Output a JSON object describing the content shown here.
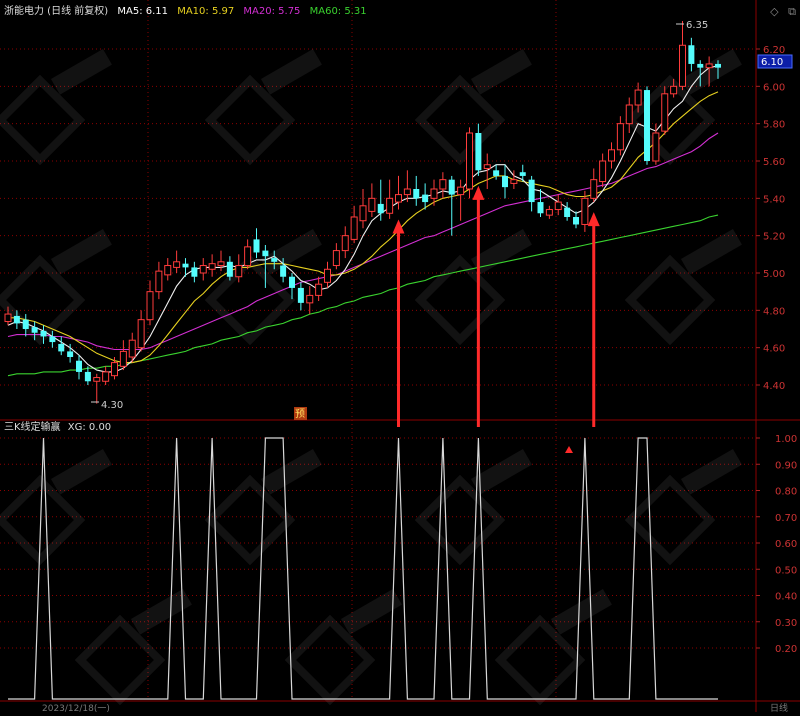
{
  "app": {
    "stock_title": "浙能电力 (日线 前复权)",
    "main_indicator": {
      "name": "MA",
      "values": [
        {
          "label": "MA5:",
          "value": "6.11",
          "color": "#ffffff"
        },
        {
          "label": "MA10:",
          "value": "5.97",
          "color": "#e6d020"
        },
        {
          "label": "MA20:",
          "value": "5.75",
          "color": "#d22fd2"
        },
        {
          "label": "MA60:",
          "value": "5.31",
          "color": "#3ad22f"
        }
      ]
    },
    "sub_indicator": {
      "name": "三K线定输赢",
      "xg_label": "XG:",
      "xg_value": "0.00"
    },
    "current_price_label": "6.10",
    "high_label": "6.35",
    "low_label": "4.30",
    "forecast_badge": "预",
    "bottom_date_label": "2023/12/18(一)",
    "bottom_right_label": "日线",
    "toolbar_icons": [
      "diamond-icon",
      "restore-icon"
    ]
  },
  "colors": {
    "up": "#ff3c3c",
    "down": "#54fcfc",
    "grid": "#8b0000",
    "axis_text": "#cc3333",
    "indicator_line": "#d8d8d8",
    "arrow": "#ff2a2a",
    "watermark": "#ffffff"
  },
  "chart_data": [
    {
      "type": "candlestick",
      "y_axis_ticks": [
        "6.20",
        "6.00",
        "5.80",
        "5.60",
        "5.40",
        "5.20",
        "5.00",
        "4.80",
        "4.60",
        "4.40"
      ],
      "ylim": [
        4.26,
        6.4
      ],
      "candles": [
        [
          4.74,
          4.78,
          4.82,
          4.72
        ],
        [
          4.77,
          4.73,
          4.8,
          4.7
        ],
        [
          4.75,
          4.7,
          4.78,
          4.66
        ],
        [
          4.71,
          4.68,
          4.74,
          4.64
        ],
        [
          4.69,
          4.66,
          4.72,
          4.62
        ],
        [
          4.66,
          4.63,
          4.69,
          4.6
        ],
        [
          4.62,
          4.58,
          4.66,
          4.56
        ],
        [
          4.58,
          4.55,
          4.62,
          4.52
        ],
        [
          4.53,
          4.47,
          4.56,
          4.43
        ],
        [
          4.47,
          4.42,
          4.5,
          4.4
        ],
        [
          4.42,
          4.44,
          4.46,
          4.3
        ],
        [
          4.42,
          4.47,
          4.5,
          4.4
        ],
        [
          4.45,
          4.52,
          4.55,
          4.43
        ],
        [
          4.5,
          4.58,
          4.64,
          4.48
        ],
        [
          4.55,
          4.64,
          4.68,
          4.52
        ],
        [
          4.6,
          4.75,
          4.8,
          4.58
        ],
        [
          4.75,
          4.9,
          4.96,
          4.72
        ],
        [
          4.9,
          5.01,
          5.06,
          4.86
        ],
        [
          4.99,
          5.04,
          5.08,
          4.96
        ],
        [
          5.03,
          5.06,
          5.12,
          5.0
        ],
        [
          5.05,
          5.03,
          5.08,
          4.98
        ],
        [
          5.03,
          4.98,
          5.06,
          4.95
        ],
        [
          5.0,
          5.04,
          5.08,
          4.96
        ],
        [
          5.02,
          5.05,
          5.1,
          4.98
        ],
        [
          5.04,
          5.06,
          5.12,
          5.01
        ],
        [
          5.06,
          4.98,
          5.09,
          4.96
        ],
        [
          4.98,
          5.04,
          5.1,
          4.95
        ],
        [
          5.04,
          5.14,
          5.18,
          5.02
        ],
        [
          5.18,
          5.11,
          5.24,
          5.08
        ],
        [
          5.12,
          5.09,
          5.15,
          4.92
        ],
        [
          5.08,
          5.06,
          5.12,
          5.02
        ],
        [
          5.04,
          4.98,
          5.08,
          4.95
        ],
        [
          4.98,
          4.92,
          5.0,
          4.86
        ],
        [
          4.92,
          4.84,
          4.95,
          4.8
        ],
        [
          4.84,
          4.88,
          4.93,
          4.78
        ],
        [
          4.88,
          4.94,
          4.98,
          4.85
        ],
        [
          4.95,
          5.02,
          5.06,
          4.92
        ],
        [
          5.04,
          5.12,
          5.16,
          5.02
        ],
        [
          5.12,
          5.2,
          5.25,
          5.08
        ],
        [
          5.18,
          5.3,
          5.36,
          5.16
        ],
        [
          5.28,
          5.36,
          5.45,
          5.24
        ],
        [
          5.33,
          5.4,
          5.48,
          5.3
        ],
        [
          5.37,
          5.32,
          5.5,
          5.28
        ],
        [
          5.32,
          5.4,
          5.5,
          5.29
        ],
        [
          5.38,
          5.42,
          5.52,
          5.34
        ],
        [
          5.42,
          5.45,
          5.55,
          5.38
        ],
        [
          5.45,
          5.4,
          5.52,
          5.36
        ],
        [
          5.42,
          5.38,
          5.48,
          5.34
        ],
        [
          5.4,
          5.45,
          5.5,
          5.36
        ],
        [
          5.45,
          5.5,
          5.54,
          5.4
        ],
        [
          5.5,
          5.42,
          5.52,
          5.2
        ],
        [
          5.42,
          5.46,
          5.5,
          5.28
        ],
        [
          5.45,
          5.75,
          5.78,
          5.4
        ],
        [
          5.75,
          5.55,
          5.8,
          5.52
        ],
        [
          5.56,
          5.58,
          5.64,
          5.45
        ],
        [
          5.55,
          5.52,
          5.58,
          5.5
        ],
        [
          5.52,
          5.46,
          5.58,
          5.4
        ],
        [
          5.48,
          5.5,
          5.55,
          5.45
        ],
        [
          5.54,
          5.52,
          5.58,
          5.49
        ],
        [
          5.5,
          5.38,
          5.52,
          5.33
        ],
        [
          5.38,
          5.32,
          5.45,
          5.3
        ],
        [
          5.31,
          5.34,
          5.36,
          5.29
        ],
        [
          5.34,
          5.38,
          5.42,
          5.31
        ],
        [
          5.35,
          5.3,
          5.38,
          5.28
        ],
        [
          5.3,
          5.26,
          5.33,
          5.24
        ],
        [
          5.26,
          5.4,
          5.44,
          5.22
        ],
        [
          5.4,
          5.5,
          5.56,
          5.38
        ],
        [
          5.49,
          5.6,
          5.64,
          5.46
        ],
        [
          5.6,
          5.66,
          5.7,
          5.56
        ],
        [
          5.66,
          5.8,
          5.84,
          5.63
        ],
        [
          5.8,
          5.9,
          5.94,
          5.75
        ],
        [
          5.9,
          5.98,
          6.02,
          5.86
        ],
        [
          5.98,
          5.6,
          6.0,
          5.58
        ],
        [
          5.6,
          5.75,
          5.8,
          5.58
        ],
        [
          5.76,
          5.96,
          6.0,
          5.74
        ],
        [
          5.96,
          6.0,
          6.04,
          5.94
        ],
        [
          6.0,
          6.22,
          6.35,
          5.98
        ],
        [
          6.22,
          6.12,
          6.26,
          6.08
        ],
        [
          6.12,
          6.1,
          6.14,
          6.0
        ],
        [
          6.1,
          6.12,
          6.16,
          6.0
        ],
        [
          6.12,
          6.1,
          6.14,
          6.04
        ]
      ],
      "ma5": [
        4.72,
        4.74,
        4.73,
        4.71,
        4.69,
        4.66,
        4.63,
        4.6,
        4.56,
        4.51,
        4.48,
        4.47,
        4.47,
        4.49,
        4.53,
        4.59,
        4.66,
        4.75,
        4.84,
        4.93,
        4.99,
        5.02,
        5.03,
        5.03,
        5.03,
        5.04,
        5.03,
        5.05,
        5.07,
        5.07,
        5.09,
        5.05,
        5.01,
        4.96,
        4.94,
        4.91,
        4.92,
        4.96,
        5.02,
        5.1,
        5.2,
        5.28,
        5.32,
        5.35,
        5.38,
        5.4,
        5.4,
        5.41,
        5.42,
        5.44,
        5.43,
        5.44,
        5.5,
        5.54,
        5.55,
        5.58,
        5.58,
        5.52,
        5.5,
        5.45,
        5.44,
        5.41,
        5.38,
        5.35,
        5.32,
        5.34,
        5.38,
        5.44,
        5.51,
        5.6,
        5.7,
        5.8,
        5.78,
        5.76,
        5.82,
        5.88,
        5.92,
        6.0,
        6.06,
        6.1,
        6.11
      ],
      "ma10": [
        4.76,
        4.76,
        4.75,
        4.74,
        4.72,
        4.7,
        4.68,
        4.66,
        4.63,
        4.6,
        4.57,
        4.55,
        4.53,
        4.52,
        4.52,
        4.53,
        4.56,
        4.61,
        4.67,
        4.73,
        4.79,
        4.85,
        4.89,
        4.94,
        4.98,
        5.01,
        5.03,
        5.03,
        5.04,
        5.05,
        5.05,
        5.05,
        5.04,
        5.03,
        5.02,
        5.01,
        4.99,
        4.99,
        5.0,
        5.02,
        5.05,
        5.09,
        5.14,
        5.18,
        5.23,
        5.28,
        5.32,
        5.35,
        5.38,
        5.4,
        5.41,
        5.42,
        5.45,
        5.48,
        5.5,
        5.52,
        5.52,
        5.5,
        5.49,
        5.48,
        5.47,
        5.46,
        5.44,
        5.42,
        5.41,
        5.41,
        5.42,
        5.44,
        5.46,
        5.5,
        5.56,
        5.62,
        5.66,
        5.7,
        5.75,
        5.8,
        5.84,
        5.88,
        5.92,
        5.95,
        5.97
      ],
      "ma20": [
        4.66,
        4.67,
        4.67,
        4.67,
        4.67,
        4.66,
        4.66,
        4.65,
        4.64,
        4.63,
        4.61,
        4.6,
        4.59,
        4.59,
        4.59,
        4.59,
        4.6,
        4.62,
        4.64,
        4.66,
        4.68,
        4.7,
        4.72,
        4.74,
        4.76,
        4.78,
        4.8,
        4.82,
        4.85,
        4.87,
        4.89,
        4.91,
        4.93,
        4.95,
        4.96,
        4.97,
        4.98,
        4.99,
        5.01,
        5.03,
        5.05,
        5.07,
        5.09,
        5.11,
        5.13,
        5.15,
        5.17,
        5.19,
        5.2,
        5.22,
        5.24,
        5.26,
        5.28,
        5.3,
        5.32,
        5.34,
        5.36,
        5.37,
        5.38,
        5.39,
        5.4,
        5.41,
        5.42,
        5.43,
        5.44,
        5.45,
        5.46,
        5.47,
        5.48,
        5.5,
        5.52,
        5.54,
        5.56,
        5.57,
        5.59,
        5.61,
        5.63,
        5.65,
        5.68,
        5.72,
        5.75
      ],
      "ma60": [
        4.45,
        4.46,
        4.46,
        4.46,
        4.47,
        4.47,
        4.47,
        4.48,
        4.48,
        4.49,
        4.49,
        4.5,
        4.5,
        4.51,
        4.52,
        4.53,
        4.54,
        4.55,
        4.56,
        4.57,
        4.58,
        4.6,
        4.61,
        4.62,
        4.64,
        4.65,
        4.66,
        4.68,
        4.69,
        4.71,
        4.72,
        4.73,
        4.75,
        4.76,
        4.78,
        4.79,
        4.81,
        4.82,
        4.84,
        4.85,
        4.87,
        4.88,
        4.89,
        4.91,
        4.92,
        4.94,
        4.95,
        4.96,
        4.98,
        4.99,
        5.0,
        5.01,
        5.02,
        5.03,
        5.04,
        5.05,
        5.06,
        5.07,
        5.08,
        5.09,
        5.1,
        5.11,
        5.12,
        5.13,
        5.14,
        5.15,
        5.16,
        5.17,
        5.18,
        5.19,
        5.2,
        5.21,
        5.22,
        5.23,
        5.24,
        5.25,
        5.26,
        5.27,
        5.28,
        5.3,
        5.31
      ],
      "signal_arrows_at": [
        44,
        53,
        66
      ]
    },
    {
      "type": "line",
      "name": "三K线定输赢",
      "y_axis_ticks": [
        "1.00",
        "0.90",
        "0.80",
        "0.70",
        "0.60",
        "0.50",
        "0.40",
        "0.30",
        "0.20"
      ],
      "ylim": [
        0,
        1
      ],
      "values": [
        0,
        0,
        0,
        0,
        1,
        0,
        0,
        0,
        0,
        0,
        0,
        0,
        0,
        0,
        0,
        0,
        0,
        0,
        0,
        1,
        0,
        0,
        0,
        1,
        0,
        0,
        0,
        0,
        0,
        1,
        1,
        1,
        0,
        0,
        0,
        0,
        0,
        0,
        0,
        0,
        0,
        0,
        0,
        0,
        1,
        0,
        0,
        0,
        0,
        1,
        0,
        0,
        0,
        1,
        0,
        0,
        0,
        0,
        0,
        0,
        0,
        0,
        0,
        0,
        0,
        1,
        0,
        0,
        0,
        0,
        0,
        1,
        1,
        0,
        0,
        0,
        0,
        0,
        0,
        0,
        0
      ]
    }
  ]
}
